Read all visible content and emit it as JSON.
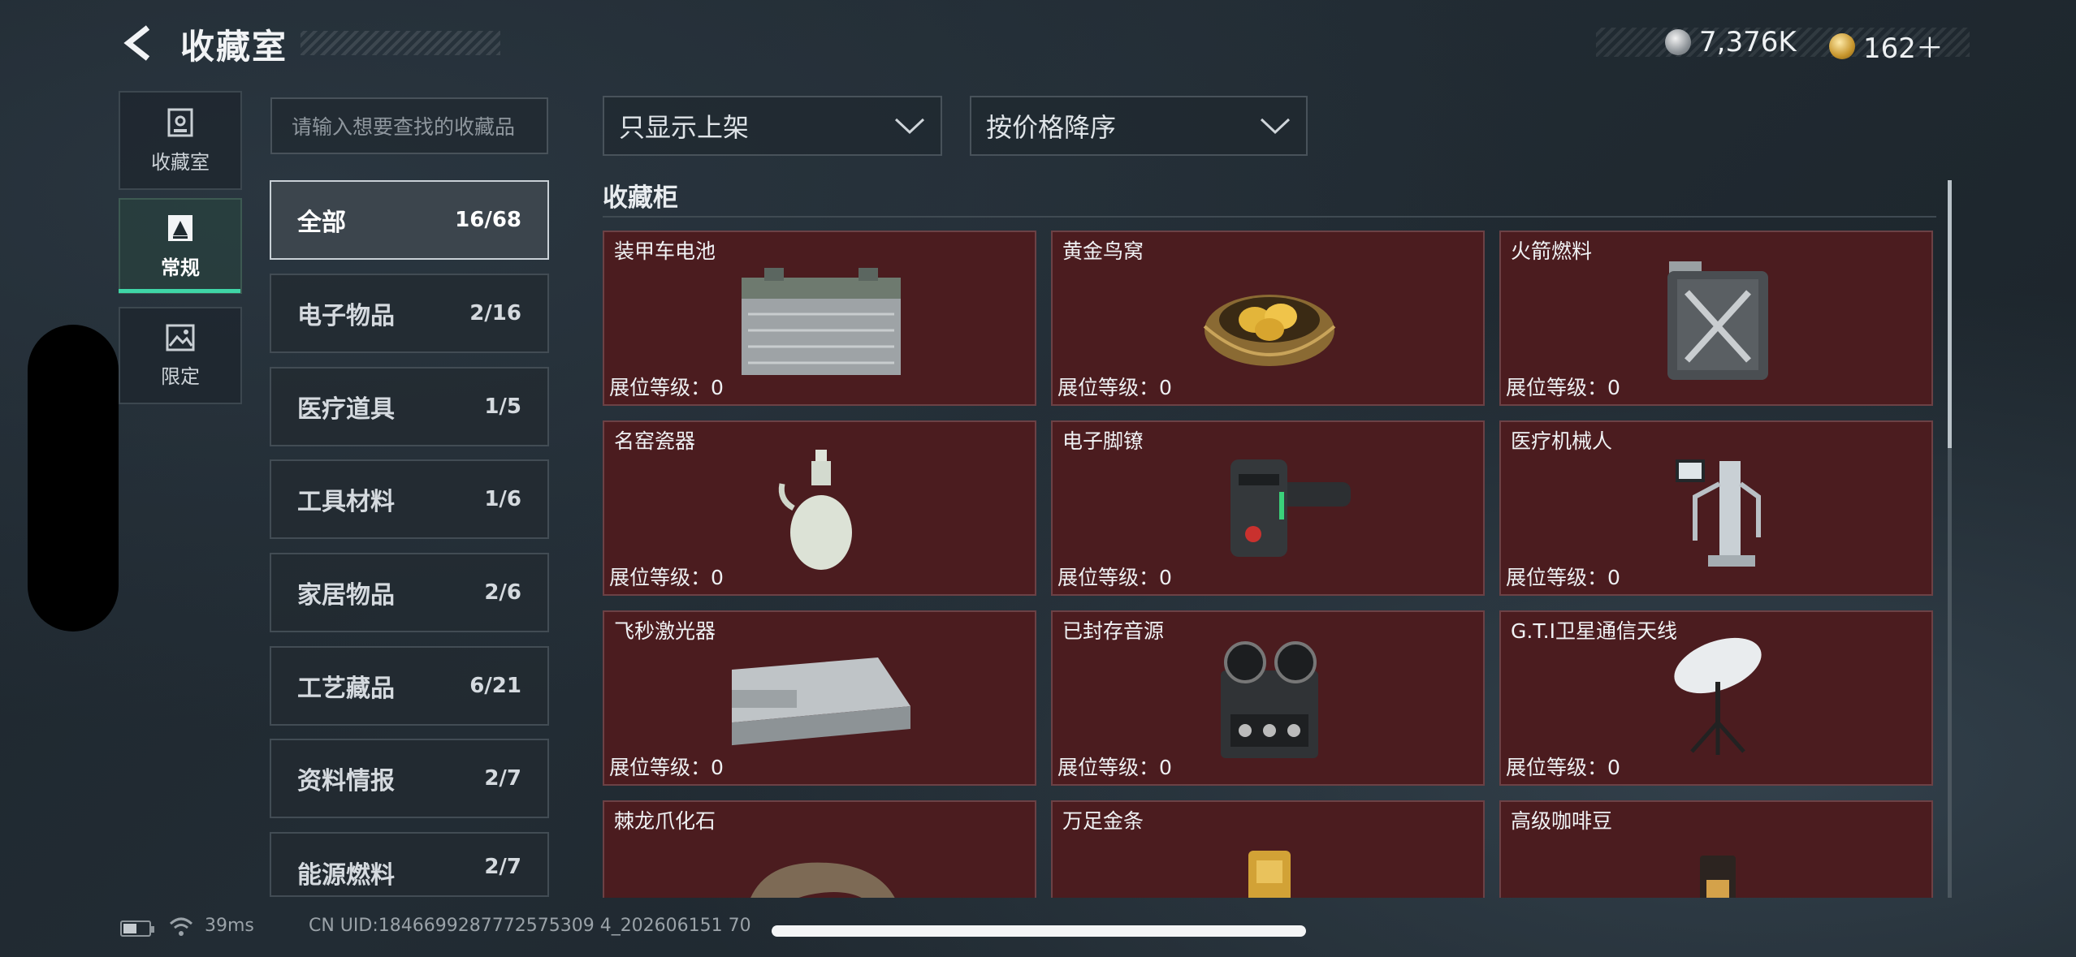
{
  "header": {
    "title": "收藏室",
    "currency": [
      {
        "icon": "silver-coin-icon",
        "value": "7,376K"
      },
      {
        "icon": "gold-coin-icon",
        "value": "162＋"
      }
    ]
  },
  "nav": {
    "items": [
      {
        "label": "收藏室",
        "icon": "collection-room-icon",
        "active": false
      },
      {
        "label": "常规",
        "icon": "regular-card-icon",
        "active": true
      },
      {
        "label": "限定",
        "icon": "limited-image-icon",
        "active": false
      }
    ],
    "accent_color": "#3fd6a7"
  },
  "search": {
    "placeholder": "请输入想要查找的收藏品"
  },
  "categories": [
    {
      "name": "全部",
      "count": "16/68",
      "active": true
    },
    {
      "name": "电子物品",
      "count": "2/16"
    },
    {
      "name": "医疗道具",
      "count": "1/5"
    },
    {
      "name": "工具材料",
      "count": "1/6"
    },
    {
      "name": "家居物品",
      "count": "2/6"
    },
    {
      "name": "工艺藏品",
      "count": "6/21"
    },
    {
      "name": "资料情报",
      "count": "2/7"
    },
    {
      "name": "能源燃料",
      "count": "2/7"
    }
  ],
  "filters": {
    "shelf": {
      "value": "只显示上架",
      "icon": "chevron-down-icon"
    },
    "sort": {
      "value": "按价格降序",
      "icon": "chevron-down-icon"
    }
  },
  "cabinet": {
    "title": "收藏柜",
    "card_color": "#4b1c1f",
    "items": [
      {
        "name": "装甲车电池",
        "level": "展位等级：0",
        "icon": "car-battery-icon"
      },
      {
        "name": "黄金鸟窝",
        "level": "展位等级：0",
        "icon": "golden-nest-icon"
      },
      {
        "name": "火箭燃料",
        "level": "展位等级：0",
        "icon": "fuel-canister-icon"
      },
      {
        "name": "名窑瓷器",
        "level": "展位等级：0",
        "icon": "porcelain-vase-icon"
      },
      {
        "name": "电子脚镣",
        "level": "展位等级：0",
        "icon": "ankle-monitor-icon"
      },
      {
        "name": "医疗机械人",
        "level": "展位等级：0",
        "icon": "medical-robot-icon"
      },
      {
        "name": "飞秒激光器",
        "level": "展位等级：0",
        "icon": "laser-device-icon"
      },
      {
        "name": "已封存音源",
        "level": "展位等级：0",
        "icon": "reel-recorder-icon"
      },
      {
        "name": "G.T.I卫星通信天线",
        "level": "展位等级：0",
        "icon": "satellite-dish-icon"
      },
      {
        "name": "棘龙爪化石",
        "level": "",
        "icon": "claw-fossil-icon"
      },
      {
        "name": "万足金条",
        "level": "",
        "icon": "gold-bar-icon"
      },
      {
        "name": "高级咖啡豆",
        "level": "",
        "icon": "coffee-bag-icon"
      }
    ]
  },
  "footer": {
    "ping": "39ms",
    "uid": "CN UID:1846699287772575309 4_202606151 70"
  }
}
